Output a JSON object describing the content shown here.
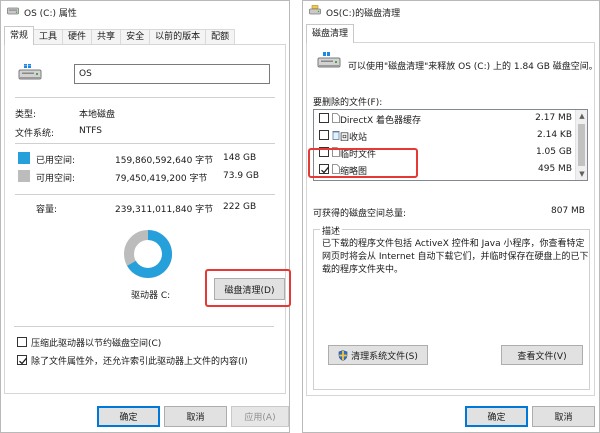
{
  "left_window": {
    "title": "OS (C:) 属性",
    "tabs": [
      "常规",
      "工具",
      "硬件",
      "共享",
      "安全",
      "以前的版本",
      "配额"
    ],
    "volume_name": "OS",
    "type_label": "类型:",
    "type_value": "本地磁盘",
    "fs_label": "文件系统:",
    "fs_value": "NTFS",
    "used_label": "已用空间:",
    "used_bytes": "159,860,592,640 字节",
    "used_gb": "148 GB",
    "free_label": "可用空间:",
    "free_bytes": "79,450,419,200 字节",
    "free_gb": "73.9 GB",
    "capacity_label": "容量:",
    "capacity_bytes": "239,311,011,840 字节",
    "capacity_gb": "222 GB",
    "drive_label": "驱动器 C:",
    "cleanup_button": "磁盘清理(D)",
    "compress_label": "压缩此驱动器以节约磁盘空间(C)",
    "compress_checked": false,
    "index_label": "除了文件属性外，还允许索引此驱动器上文件的内容(I)",
    "index_checked": true,
    "ok_button": "确定",
    "cancel_button": "取消",
    "apply_button": "应用(A)",
    "used_fraction": 0.668,
    "used_color": "#26a0da",
    "free_color": "#bcbcbc"
  },
  "right_window": {
    "title": "OS(C:)的磁盘清理",
    "tab": "磁盘清理",
    "intro_text": "可以使用\"磁盘清理\"来释放 OS (C:) 上的 1.84 GB 磁盘空间。",
    "files_label": "要删除的文件(F):",
    "files": [
      {
        "name": "DirectX 着色器缓存",
        "size": "2.17 MB",
        "checked": false,
        "icon": "file-icon"
      },
      {
        "name": "回收站",
        "size": "2.14 KB",
        "checked": false,
        "icon": "recycle-bin-icon"
      },
      {
        "name": "临时文件",
        "size": "1.05 GB",
        "checked": false,
        "icon": "file-icon"
      },
      {
        "name": "缩略图",
        "size": "495 MB",
        "checked": true,
        "icon": "file-icon"
      }
    ],
    "total_label": "可获得的磁盘空间总量:",
    "total_value": "807 MB",
    "desc_title": "描述",
    "desc_text": "已下载的程序文件包括 ActiveX 控件和 Java 小程序，你查看特定网页时将会从 Internet 自动下载它们，并临时保存在硬盘上的已下载的程序文件夹中。",
    "clean_system_button": "清理系统文件(S)",
    "view_files_button": "查看文件(V)",
    "ok_button": "确定",
    "cancel_button": "取消"
  },
  "icons": {
    "drive": "hard-drive-icon",
    "shield": "uac-shield-icon",
    "checkmark": "checkmark-icon"
  },
  "colors": {
    "highlight": "#e53935",
    "accent": "#0078d7"
  }
}
